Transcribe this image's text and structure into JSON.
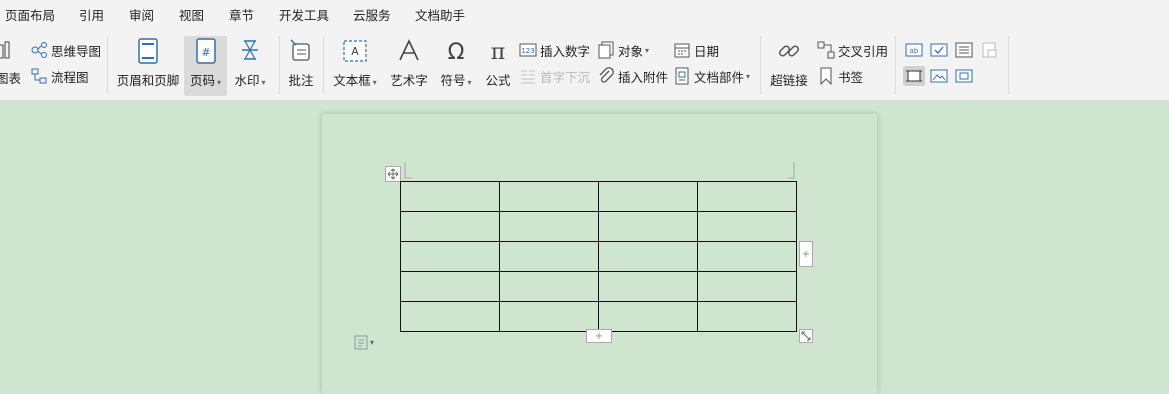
{
  "menu": {
    "items": [
      "页面布局",
      "引用",
      "审阅",
      "视图",
      "章节",
      "开发工具",
      "云服务",
      "文档助手"
    ]
  },
  "ribbon": {
    "chart_label": "图表",
    "mindmap_label": "思维导图",
    "flowchart_label": "流程图",
    "header_footer_label": "页眉和页脚",
    "page_number_label": "页码",
    "watermark_label": "水印",
    "comment_label": "批注",
    "textbox_label": "文本框",
    "wordart_label": "艺术字",
    "symbol_label": "符号",
    "formula_label": "公式",
    "insert_number_label": "插入数字",
    "object_label": "对象",
    "date_label": "日期",
    "dropcap_label": "首字下沉",
    "attachment_label": "插入附件",
    "docparts_label": "文档部件",
    "hyperlink_label": "超链接",
    "crossref_label": "交叉引用",
    "bookmark_label": "书签"
  },
  "colors": {
    "background": "#cfe5d0",
    "toolbar": "#f3f3f3",
    "icon_blue": "#2f6fb6"
  },
  "document": {
    "table": {
      "rows": 5,
      "cols": 4
    }
  }
}
